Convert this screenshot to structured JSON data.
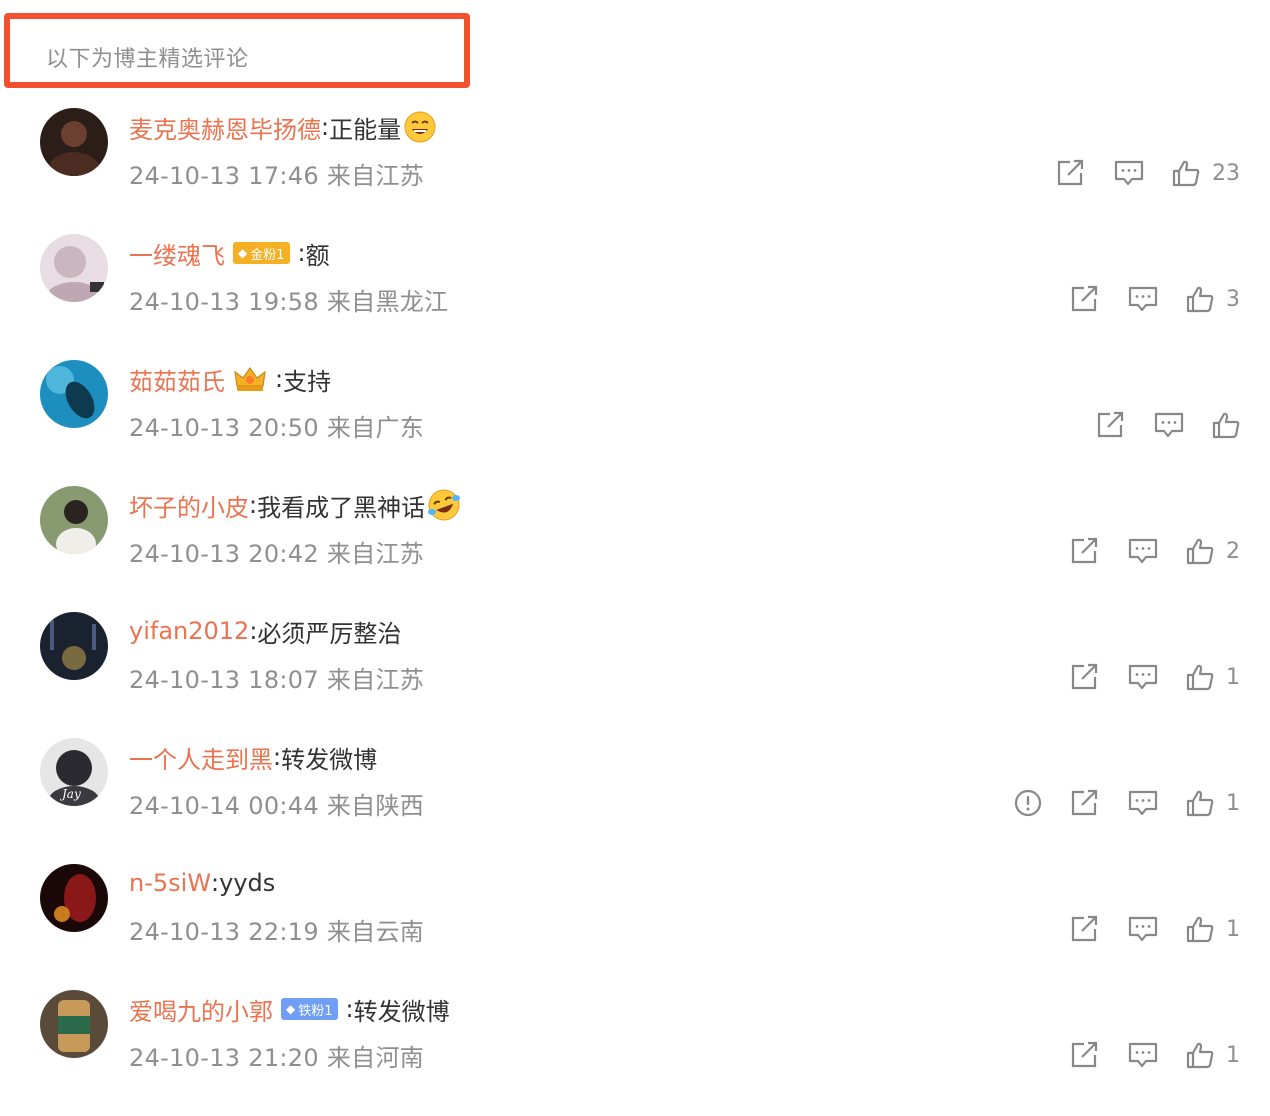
{
  "header": {
    "title": "以下为博主精选评论"
  },
  "comments": [
    {
      "username": "麦克奥赫恩毕扬德",
      "separator": ":",
      "text": "正能量",
      "meta": "24-10-13 17:46 来自江苏",
      "likes": "23",
      "badge": "",
      "avatar_color": "#3b2a22"
    },
    {
      "username": "一缕魂飞",
      "separator": ":",
      "text": "额",
      "meta": "24-10-13 19:58 来自黑龙江",
      "likes": "3",
      "badge": "金粉1",
      "avatar_color": "#d8c9cf"
    },
    {
      "username": "茹茹茹氏",
      "separator": ":",
      "text": "支持",
      "meta": "24-10-13 20:50 来自广东",
      "likes": "",
      "badge": "",
      "avatar_color": "#1c8ab8"
    },
    {
      "username": "坏子的小皮",
      "separator": ":",
      "text": "我看成了黑神话",
      "meta": "24-10-13 20:42 来自江苏",
      "likes": "2",
      "badge": "",
      "avatar_color": "#6d7a5a"
    },
    {
      "username": "yifan2012",
      "separator": ":",
      "text": "必须严厉整治",
      "meta": "24-10-13 18:07 来自江苏",
      "likes": "1",
      "badge": "",
      "avatar_color": "#1e2633"
    },
    {
      "username": "一个人走到黑",
      "separator": ":",
      "text": "转发微博",
      "meta": "24-10-14 00:44 来自陕西",
      "likes": "1",
      "badge": "",
      "avatar_color": "#2a2a30"
    },
    {
      "username": "n-5siW",
      "separator": ":",
      "text": "yyds",
      "meta": "24-10-13 22:19 来自云南",
      "likes": "1",
      "badge": "",
      "avatar_color": "#5a1414"
    },
    {
      "username": "爱喝九的小郭",
      "separator": ":",
      "text": "转发微博",
      "meta": "24-10-13 21:20 来自河南",
      "likes": "1",
      "badge": "铁粉1",
      "avatar_color": "#7a5a3a"
    }
  ],
  "colors": {
    "accent_border": "#f2502f",
    "username": "#eb7350",
    "meta_text": "#8f8f8f",
    "gold_badge": "#f5b026",
    "iron_badge": "#6f9ef4"
  },
  "icons": [
    "report-icon",
    "repost-icon",
    "reply-icon",
    "like-icon",
    "grin-emoji",
    "laugh-cry-emoji",
    "crown-icon",
    "diamond-icon"
  ]
}
